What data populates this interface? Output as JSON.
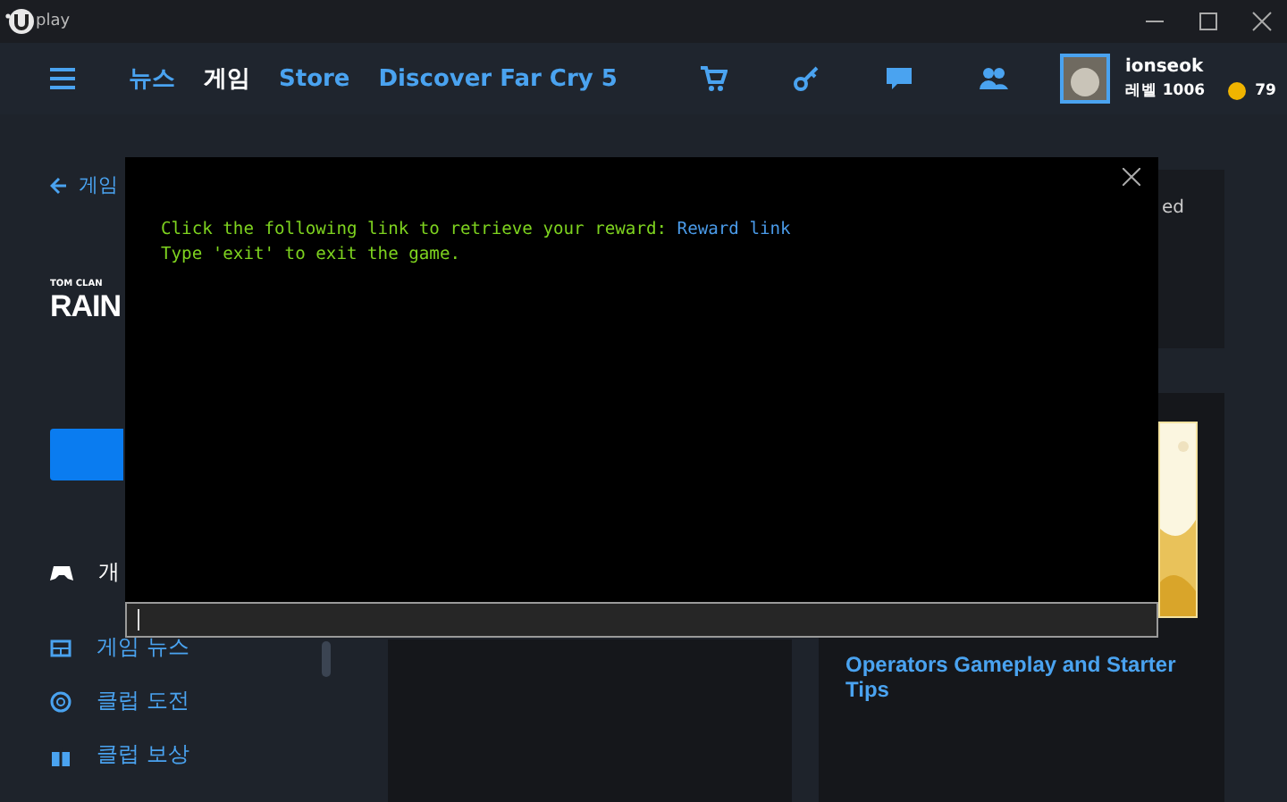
{
  "window": {
    "app_name": "play"
  },
  "nav": {
    "items": [
      {
        "label": "뉴스",
        "selected": false
      },
      {
        "label": "게임",
        "selected": true
      },
      {
        "label": "Store",
        "selected": false
      },
      {
        "label": "Discover Far Cry 5",
        "selected": false
      }
    ]
  },
  "user": {
    "name": "ionseok",
    "level": "레벨 1006",
    "coins": "79"
  },
  "sidebar": {
    "back": "게임",
    "logo_small": "TOM CLAN",
    "logo_big": "RAIN",
    "items": [
      {
        "label": "개",
        "selected": true
      },
      {
        "label": "게임 뉴스",
        "selected": false
      },
      {
        "label": "클럽 도전",
        "selected": false
      },
      {
        "label": "클럽 보상",
        "selected": false
      }
    ]
  },
  "right": {
    "top_card_text": "ed",
    "article_title": "Operators Gameplay and Starter Tips"
  },
  "console": {
    "lines": [
      {
        "text": "Click the following link to retrieve your reward: ",
        "link": "Reward link"
      },
      {
        "text": "Type 'exit' to exit the game."
      }
    ]
  }
}
